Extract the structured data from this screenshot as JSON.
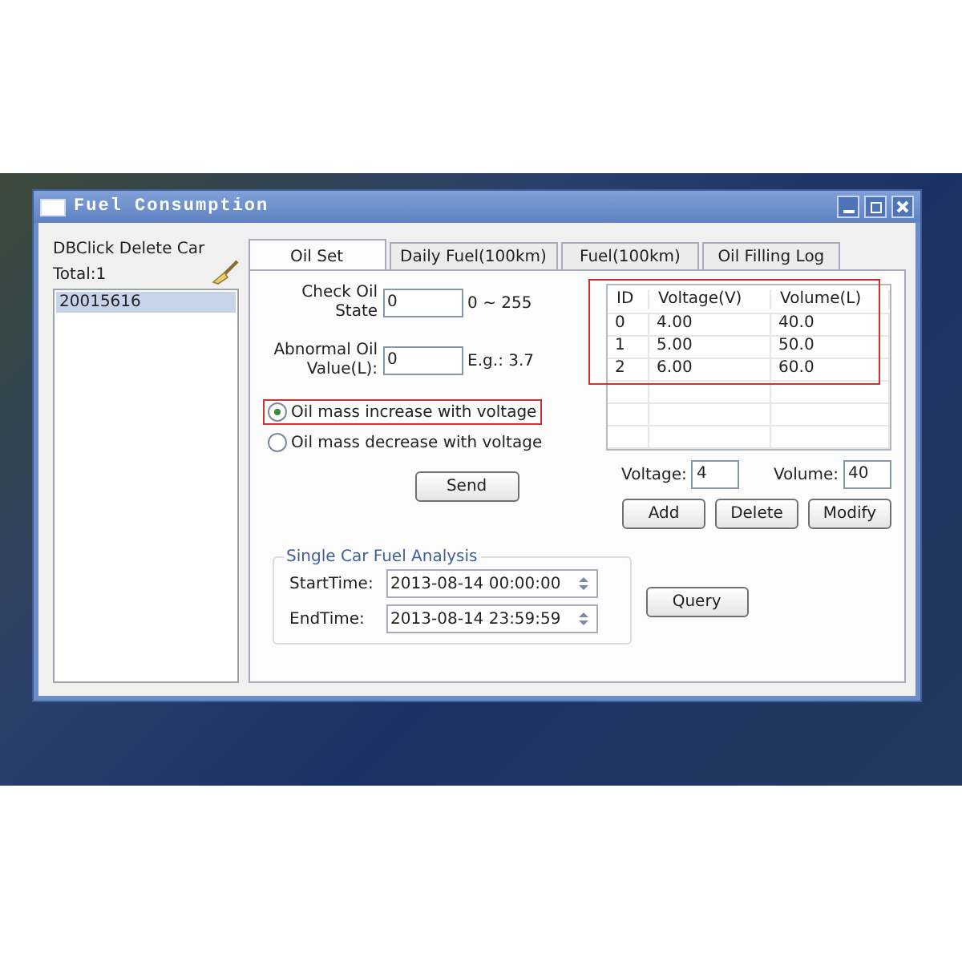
{
  "window": {
    "title": "Fuel Consumption"
  },
  "car_list": {
    "header": "DBClick Delete Car",
    "total": "Total:1",
    "items": [
      {
        "label": "20015616",
        "selected": true
      }
    ]
  },
  "tabs": [
    {
      "label": "Oil Set",
      "selected": true
    },
    {
      "label": "Daily Fuel(100km)",
      "selected": false
    },
    {
      "label": "Fuel(100km)",
      "selected": false
    },
    {
      "label": "Oil Filling Log",
      "selected": false
    }
  ],
  "oil_set": {
    "fields": [
      {
        "label": "Check Oil State",
        "value": "0",
        "hint": "0 ~ 255"
      },
      {
        "label": "Abnormal Oil Value(L):",
        "value": "0",
        "hint": "E.g.: 3.7"
      }
    ],
    "options": [
      {
        "label": "Oil mass increase with voltage",
        "selected": true,
        "highlighted": true
      },
      {
        "label": "Oil mass decrease with voltage",
        "selected": false,
        "highlighted": false
      }
    ],
    "send_button": "Send"
  },
  "table": {
    "highlighted": true,
    "columns": [
      "ID",
      "Voltage(V)",
      "Volume(L)"
    ],
    "rows": [
      [
        "0",
        "4.00",
        "40.0"
      ],
      [
        "1",
        "5.00",
        "50.0"
      ],
      [
        "2",
        "6.00",
        "60.0"
      ]
    ]
  },
  "entry": [
    {
      "label": "Voltage:",
      "value": "4"
    },
    {
      "label": "Volume:",
      "value": "40"
    }
  ],
  "table_buttons": [
    "Add",
    "Delete",
    "Modify"
  ],
  "analysis": {
    "title": "Single Car Fuel Analysis",
    "times": [
      {
        "label": "StartTime:",
        "value": "2013-08-14 00:00:00"
      },
      {
        "label": "EndTime:",
        "value": "2013-08-14 23:59:59"
      }
    ],
    "query_button": "Query"
  }
}
